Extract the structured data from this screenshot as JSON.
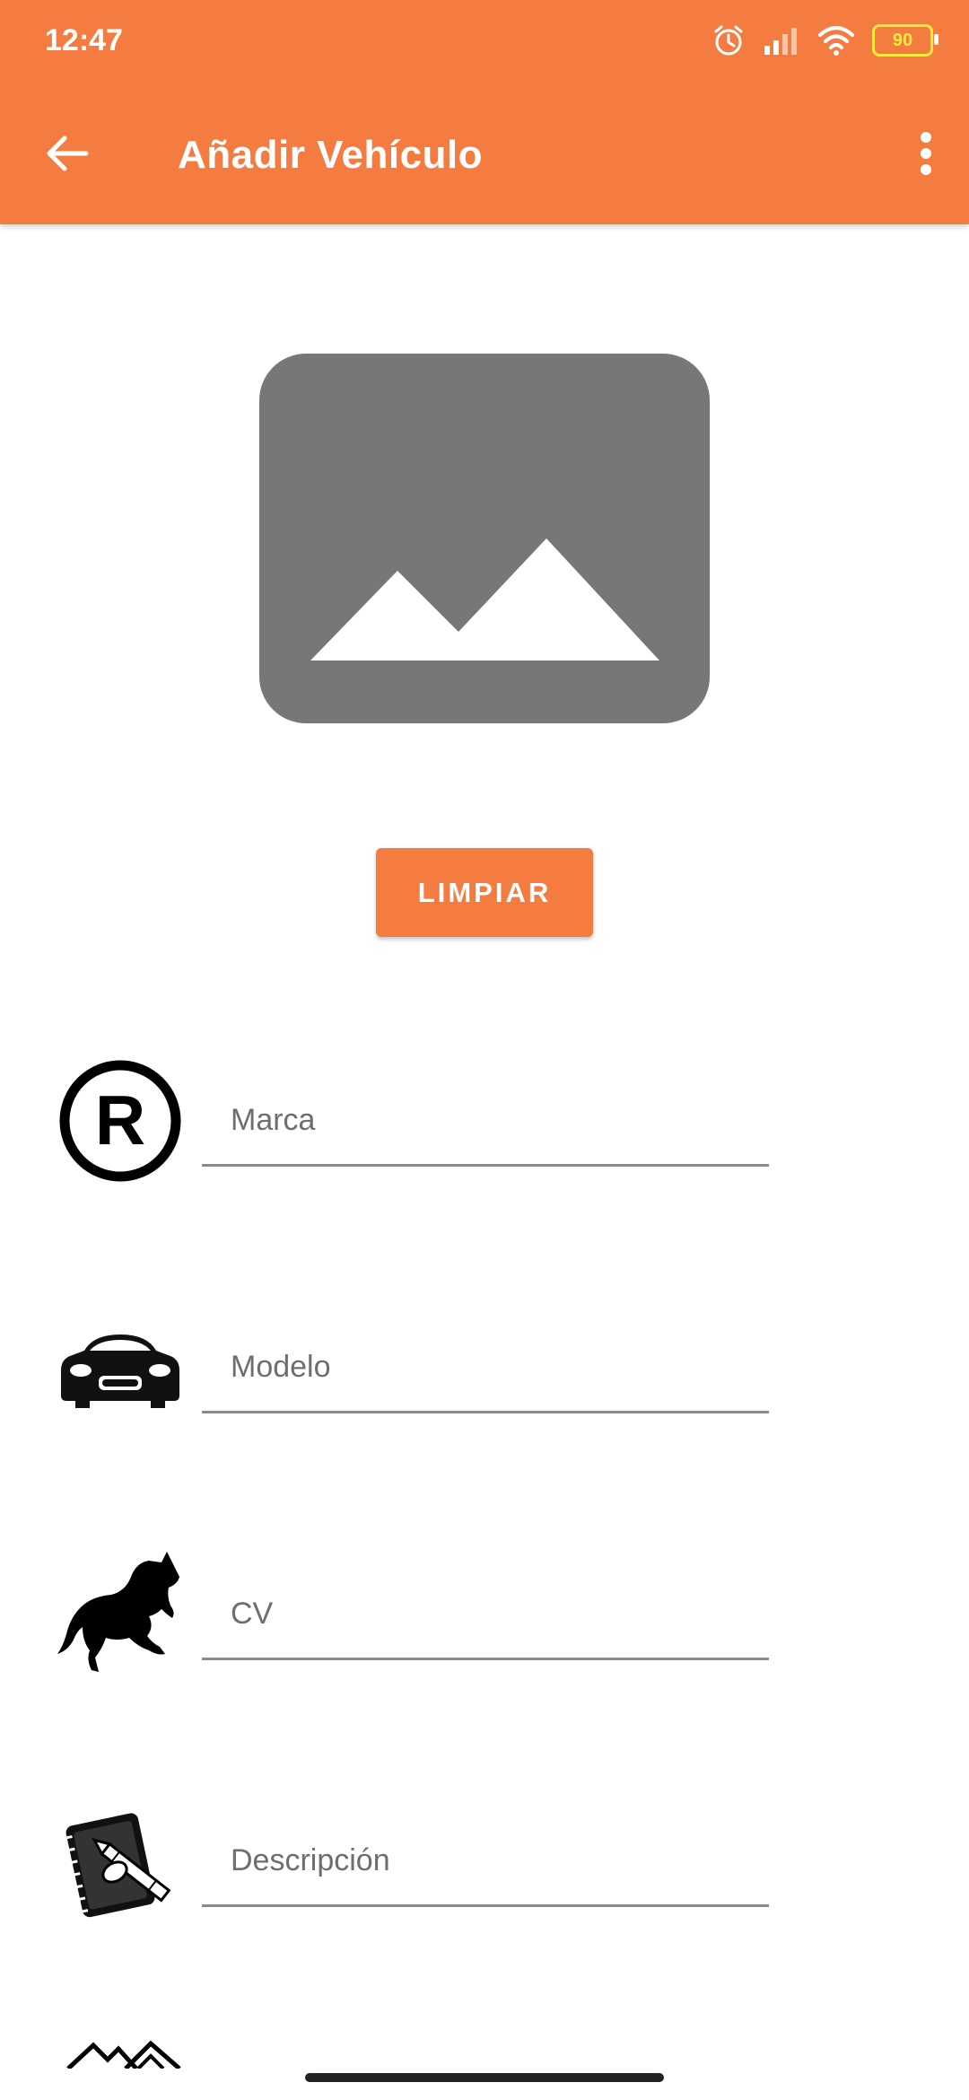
{
  "status_bar": {
    "time": "12:47",
    "battery_level": "90",
    "icons": [
      "alarm-icon",
      "signal-icon",
      "wifi-icon",
      "battery-icon"
    ]
  },
  "app_bar": {
    "title": "Añadir Vehículo",
    "back_icon": "arrow-left-icon",
    "menu_icon": "more-vert-icon"
  },
  "image_picker": {
    "icon": "image-placeholder-icon"
  },
  "actions": {
    "clear_label": "LIMPIAR"
  },
  "form": {
    "fields": [
      {
        "icon": "registered-trademark-icon",
        "placeholder": "Marca",
        "value": ""
      },
      {
        "icon": "car-icon",
        "placeholder": "Modelo",
        "value": ""
      },
      {
        "icon": "horse-icon",
        "placeholder": "CV",
        "value": ""
      },
      {
        "icon": "notebook-icon",
        "placeholder": "Descripción",
        "value": ""
      }
    ]
  },
  "colors": {
    "primary": "#F47C40",
    "placeholder_gray": "#777777",
    "underline": "#8a8a8a"
  }
}
